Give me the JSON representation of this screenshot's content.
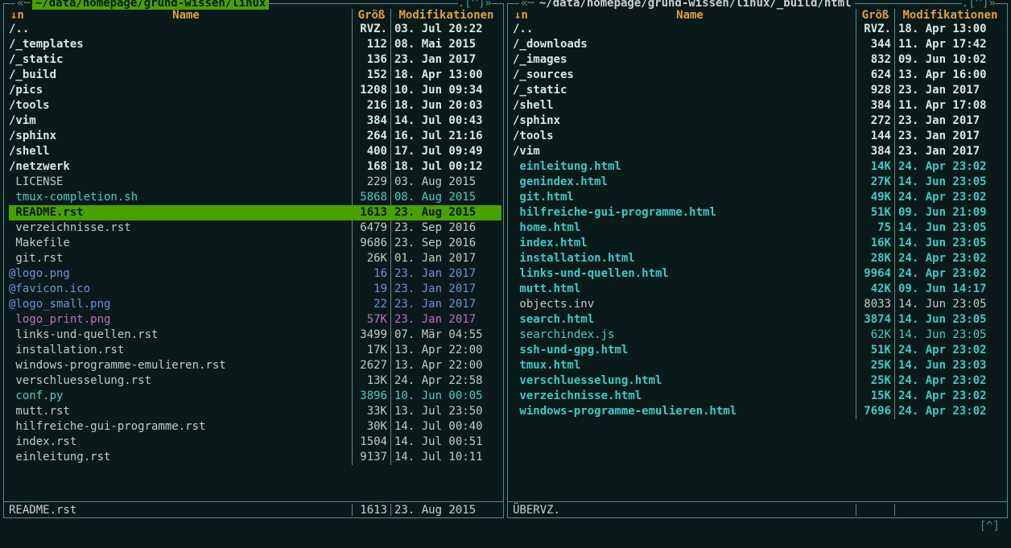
{
  "left": {
    "path": "~/data/homepage/grund-wissen/linux",
    "active": true,
    "title_right": ".[^]»",
    "arrow": "«─ ",
    "sort": "↓n",
    "cols": {
      "name": "Name",
      "size": "Größ",
      "mod": "Modifikationen"
    },
    "files": [
      {
        "name": "/..",
        "size": "RVZ.",
        "mod": "03. Jul 20:22",
        "cls": "c-dir"
      },
      {
        "name": "/_templates",
        "size": "112",
        "mod": "08. Mai 2015",
        "cls": "c-dir"
      },
      {
        "name": "/_static",
        "size": "136",
        "mod": "23. Jan 2017",
        "cls": "c-dir"
      },
      {
        "name": "/_build",
        "size": "152",
        "mod": "18. Apr 13:00",
        "cls": "c-dir"
      },
      {
        "name": "/pics",
        "size": "1208",
        "mod": "10. Jun 09:34",
        "cls": "c-dir"
      },
      {
        "name": "/tools",
        "size": "216",
        "mod": "18. Jun 20:03",
        "cls": "c-dir"
      },
      {
        "name": "/vim",
        "size": "384",
        "mod": "14. Jul 00:43",
        "cls": "c-dir"
      },
      {
        "name": "/sphinx",
        "size": "264",
        "mod": "16. Jul 21:16",
        "cls": "c-dir"
      },
      {
        "name": "/shell",
        "size": "400",
        "mod": "17. Jul 09:49",
        "cls": "c-dir"
      },
      {
        "name": "/netzwerk",
        "size": "168",
        "mod": "18. Jul 00:12",
        "cls": "c-dir"
      },
      {
        "name": " LICENSE",
        "size": "229",
        "mod": "03. Aug 2015",
        "cls": "c-file"
      },
      {
        "name": " tmux-completion.sh",
        "size": "5868",
        "mod": "08. Aug 2015",
        "cls": "c-exec"
      },
      {
        "name": " README.rst",
        "size": "1613",
        "mod": "23. Aug 2015",
        "cls": "c-file",
        "selected": true
      },
      {
        "name": " verzeichnisse.rst",
        "size": "6479",
        "mod": "23. Sep 2016",
        "cls": "c-file"
      },
      {
        "name": " Makefile",
        "size": "9686",
        "mod": "23. Sep 2016",
        "cls": "c-file"
      },
      {
        "name": " git.rst",
        "size": "26K",
        "mod": "01. Jan 2017",
        "cls": "c-file"
      },
      {
        "name": "@logo.png",
        "size": "16",
        "mod": "23. Jan 2017",
        "cls": "c-link"
      },
      {
        "name": "@favicon.ico",
        "size": "19",
        "mod": "23. Jan 2017",
        "cls": "c-link"
      },
      {
        "name": "@logo_small.png",
        "size": "22",
        "mod": "23. Jan 2017",
        "cls": "c-link"
      },
      {
        "name": " logo_print.png",
        "size": "57K",
        "mod": "23. Jan 2017",
        "cls": "c-media"
      },
      {
        "name": " links-und-quellen.rst",
        "size": "3499",
        "mod": "07. Mär 04:55",
        "cls": "c-file"
      },
      {
        "name": " installation.rst",
        "size": "17K",
        "mod": "13. Apr 22:00",
        "cls": "c-file"
      },
      {
        "name": " windows-programme-emulieren.rst",
        "size": "2627",
        "mod": "13. Apr 22:00",
        "cls": "c-file"
      },
      {
        "name": " verschluesselung.rst",
        "size": "13K",
        "mod": "24. Apr 22:58",
        "cls": "c-file"
      },
      {
        "name": " conf.py",
        "size": "3896",
        "mod": "10. Jun 00:05",
        "cls": "c-exec"
      },
      {
        "name": " mutt.rst",
        "size": "33K",
        "mod": "13. Jul 23:50",
        "cls": "c-file"
      },
      {
        "name": " hilfreiche-gui-programme.rst",
        "size": "30K",
        "mod": "14. Jul 00:40",
        "cls": "c-file"
      },
      {
        "name": " index.rst",
        "size": "1504",
        "mod": "14. Jul 00:51",
        "cls": "c-file"
      },
      {
        "name": " einleitung.rst",
        "size": "9137",
        "mod": "14. Jul 10:11",
        "cls": "c-file"
      }
    ],
    "status": {
      "name": "README.rst",
      "size": "1613",
      "mod": "23. Aug 2015"
    }
  },
  "right": {
    "path": "~/data/homepage/grund-wissen/linux/_build/html",
    "active": false,
    "title_right": ".[^]»",
    "arrow": "«─ ",
    "sort": "↓n",
    "cols": {
      "name": "Name",
      "size": "Größ",
      "mod": "Modifikationen"
    },
    "files": [
      {
        "name": "/..",
        "size": "RVZ.",
        "mod": "18. Apr 13:00",
        "cls": "c-dir"
      },
      {
        "name": "/_downloads",
        "size": "344",
        "mod": "11. Apr 17:42",
        "cls": "c-dir"
      },
      {
        "name": "/_images",
        "size": "832",
        "mod": "09. Jun 10:02",
        "cls": "c-dir"
      },
      {
        "name": "/_sources",
        "size": "624",
        "mod": "13. Apr 16:00",
        "cls": "c-dir"
      },
      {
        "name": "/_static",
        "size": "928",
        "mod": "23. Jan 2017",
        "cls": "c-dir"
      },
      {
        "name": "/shell",
        "size": "384",
        "mod": "11. Apr 17:08",
        "cls": "c-dir"
      },
      {
        "name": "/sphinx",
        "size": "272",
        "mod": "23. Jan 2017",
        "cls": "c-dir"
      },
      {
        "name": "/tools",
        "size": "144",
        "mod": "23. Jan 2017",
        "cls": "c-dir"
      },
      {
        "name": "/vim",
        "size": "384",
        "mod": "23. Jan 2017",
        "cls": "c-dir"
      },
      {
        "name": " einleitung.html",
        "size": "14K",
        "mod": "24. Apr 23:02",
        "cls": "c-html"
      },
      {
        "name": " genindex.html",
        "size": "27K",
        "mod": "14. Jun 23:05",
        "cls": "c-html"
      },
      {
        "name": " git.html",
        "size": "49K",
        "mod": "24. Apr 23:02",
        "cls": "c-html"
      },
      {
        "name": " hilfreiche-gui-programme.html",
        "size": "51K",
        "mod": "09. Jun 21:09",
        "cls": "c-html"
      },
      {
        "name": " home.html",
        "size": "75",
        "mod": "14. Jun 23:05",
        "cls": "c-html"
      },
      {
        "name": " index.html",
        "size": "16K",
        "mod": "14. Jun 23:05",
        "cls": "c-html"
      },
      {
        "name": " installation.html",
        "size": "28K",
        "mod": "24. Apr 23:02",
        "cls": "c-html"
      },
      {
        "name": " links-und-quellen.html",
        "size": "9964",
        "mod": "24. Apr 23:02",
        "cls": "c-html"
      },
      {
        "name": " mutt.html",
        "size": "42K",
        "mod": "09. Jun 14:17",
        "cls": "c-html"
      },
      {
        "name": " objects.inv",
        "size": "8033",
        "mod": "14. Jun 23:05",
        "cls": "c-file"
      },
      {
        "name": " search.html",
        "size": "3874",
        "mod": "14. Jun 23:05",
        "cls": "c-html"
      },
      {
        "name": " searchindex.js",
        "size": "62K",
        "mod": "14. Jun 23:05",
        "cls": "c-exec"
      },
      {
        "name": " ssh-und-gpg.html",
        "size": "51K",
        "mod": "24. Apr 23:02",
        "cls": "c-html"
      },
      {
        "name": " tmux.html",
        "size": "25K",
        "mod": "14. Jun 23:03",
        "cls": "c-html"
      },
      {
        "name": " verschluesselung.html",
        "size": "25K",
        "mod": "24. Apr 23:02",
        "cls": "c-html"
      },
      {
        "name": " verzeichnisse.html",
        "size": "15K",
        "mod": "24. Apr 23:02",
        "cls": "c-html"
      },
      {
        "name": " windows-programme-emulieren.html",
        "size": "7696",
        "mod": "24. Apr 23:02",
        "cls": "c-html"
      }
    ],
    "status": {
      "name": "ÜBERVZ.",
      "size": "",
      "mod": ""
    }
  },
  "bottom": "[^]"
}
